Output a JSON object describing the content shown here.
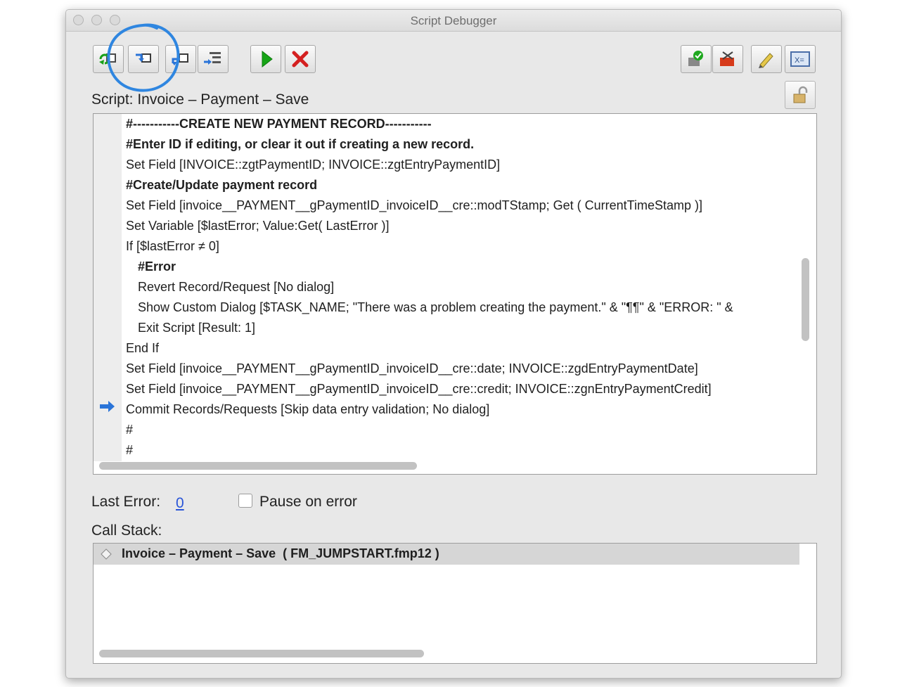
{
  "window": {
    "title": "Script Debugger"
  },
  "toolbar": {
    "buttons": [
      {
        "name": "step-over",
        "icon": "step-over-icon"
      },
      {
        "name": "step-into",
        "icon": "step-into-icon"
      },
      {
        "name": "step-out",
        "icon": "step-out-icon"
      },
      {
        "name": "set-next-step",
        "icon": "set-next-step-icon"
      },
      {
        "name": "run",
        "icon": "green-play-icon"
      },
      {
        "name": "halt",
        "icon": "red-x-icon"
      },
      {
        "name": "set-clear-breakpoint",
        "icon": "breakpoint-icon"
      },
      {
        "name": "remove-breakpoints",
        "icon": "remove-breakpoints-icon"
      },
      {
        "name": "edit-script",
        "icon": "pencil-icon"
      },
      {
        "name": "data-viewer",
        "icon": "data-viewer-icon"
      }
    ],
    "accent_colors": {
      "run": "#16a516",
      "halt": "#d42020",
      "arrow": "#2a74d8"
    }
  },
  "script": {
    "label": "Script: Invoice – Payment – Save",
    "lines": [
      {
        "text": "#-----------CREATE NEW PAYMENT RECORD-----------",
        "bold": true,
        "indent": 0
      },
      {
        "text": "#Enter ID if editing, or clear it out if creating a new record.",
        "bold": true,
        "indent": 0
      },
      {
        "text": "Set Field [INVOICE::zgtPaymentID; INVOICE::zgtEntryPaymentID]",
        "bold": false,
        "indent": 0
      },
      {
        "text": "#Create/Update payment record",
        "bold": true,
        "indent": 0
      },
      {
        "text": "Set Field [invoice__PAYMENT__gPaymentID_invoiceID__cre::modTStamp; Get ( CurrentTimeStamp )]",
        "bold": false,
        "indent": 0
      },
      {
        "text": "Set Variable [$lastError; Value:Get( LastError )]",
        "bold": false,
        "indent": 0
      },
      {
        "text": "If [$lastError ≠ 0]",
        "bold": false,
        "indent": 0
      },
      {
        "text": "#Error",
        "bold": true,
        "indent": 1
      },
      {
        "text": "Revert Record/Request [No dialog]",
        "bold": false,
        "indent": 1
      },
      {
        "text": "Show Custom Dialog [$TASK_NAME; \"There was a problem creating the payment.\" & \"¶¶\" & \"ERROR: \" &",
        "bold": false,
        "indent": 1
      },
      {
        "text": "Exit Script [Result: 1]",
        "bold": false,
        "indent": 1
      },
      {
        "text": "End If",
        "bold": false,
        "indent": 0
      },
      {
        "text": "Set Field [invoice__PAYMENT__gPaymentID_invoiceID__cre::date; INVOICE::zgdEntryPaymentDate]",
        "bold": false,
        "indent": 0
      },
      {
        "text": "Set Field [invoice__PAYMENT__gPaymentID_invoiceID__cre::credit; INVOICE::zgnEntryPaymentCredit]",
        "bold": false,
        "indent": 0
      },
      {
        "text": "Commit Records/Requests [Skip data entry validation; No dialog]",
        "bold": false,
        "indent": 0
      },
      {
        "text": "#",
        "bold": false,
        "indent": 0
      },
      {
        "text": "#",
        "bold": false,
        "indent": 0
      }
    ],
    "current_line": 15
  },
  "status": {
    "last_error_label": "Last Error:",
    "last_error_value": "0",
    "pause_on_error_label": "Pause on error",
    "pause_on_error_checked": false
  },
  "call_stack": {
    "label": "Call Stack:",
    "items": [
      {
        "text": "Invoice – Payment – Save  ( FM_JUMPSTART.fmp12 )"
      }
    ]
  }
}
